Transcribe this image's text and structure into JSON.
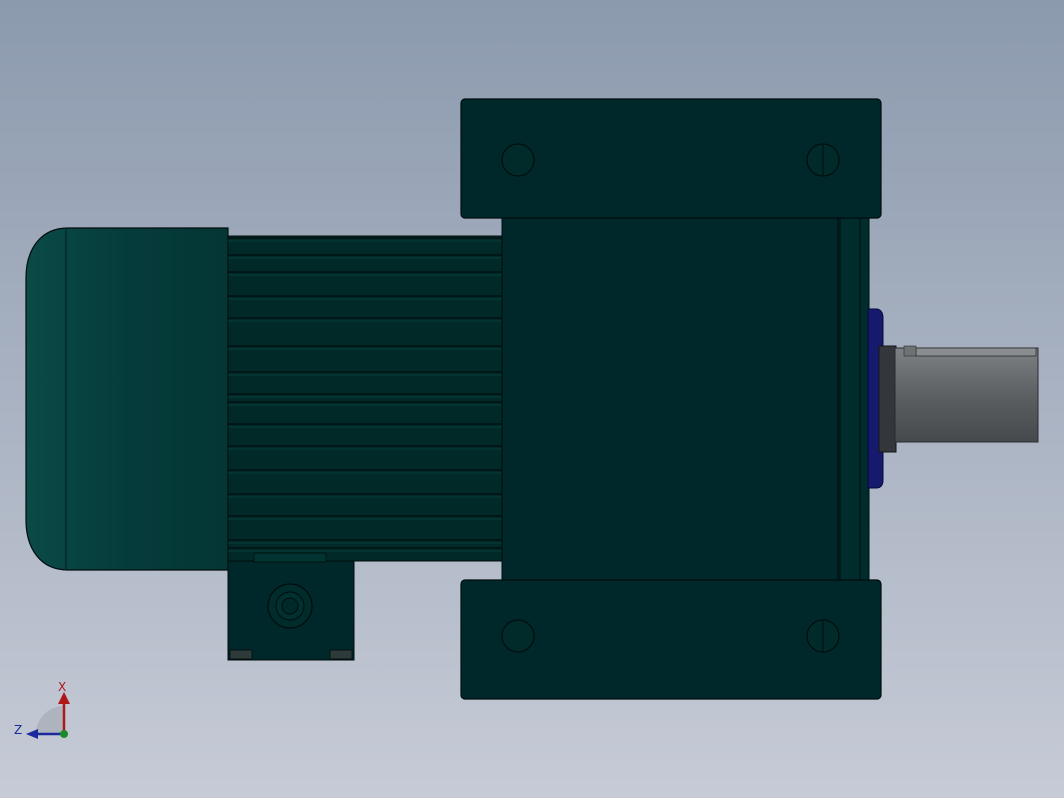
{
  "viewport": {
    "background_top": "#8c9aae",
    "background_bottom": "#c6cbd6"
  },
  "colors": {
    "body": "#00282a",
    "body_mid": "#002c2b",
    "motor_cap": "#053c3b",
    "edge": "#000d0e",
    "fin_light": "#0c4a45",
    "bearing_blue": "#151a6e",
    "shaft": "#5f6366",
    "shaft_light": "#8a8d8f"
  },
  "triad": {
    "x_label": "X",
    "z_label": "Z",
    "x_color": "#b01818",
    "z_color": "#1a2a9c",
    "origin_color": "#1b8a2a"
  }
}
